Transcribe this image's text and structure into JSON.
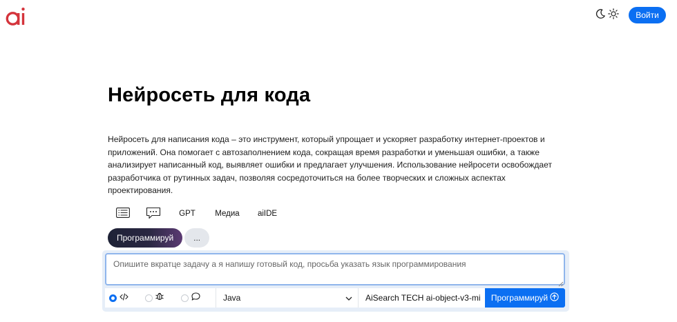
{
  "header": {
    "logo_text": "ai",
    "theme_icons": [
      "moon-icon",
      "sun-icon"
    ],
    "login_label": "Войти"
  },
  "page": {
    "title": "Нейросеть для кода",
    "description": "Нейросеть для написания кода – это инструмент, который упрощает и ускоряет разработку интернет-проектов и приложений. Она помогает с автозаполнением кода, сокращая время разработки и уменьшая ошибки, а также анализирует написанный код, выявляет ошибки и предлагает улучшения. Использование нейросети освобождает разработчика от рутинных задач, позволяя сосредоточиться на более творческих и сложных аспектах проектирования."
  },
  "modes": {
    "items": [
      {
        "icon": "list-icon"
      },
      {
        "icon": "chat-icon"
      },
      {
        "label": "GPT"
      },
      {
        "label": "Медиа"
      },
      {
        "label": "aiIDE"
      }
    ]
  },
  "submodes": {
    "active_label": "Программируй",
    "more_label": "..."
  },
  "composer": {
    "placeholder": "Опишите вкратце задачу а я напишу готовый код, просьба указать язык программирования",
    "value": "",
    "task_types": [
      {
        "icon": "code-icon",
        "selected": true
      },
      {
        "icon": "bug-icon",
        "selected": false
      },
      {
        "icon": "comment-icon",
        "selected": false
      }
    ],
    "language_select": "Java",
    "model_select": "AiSearch TECH ai-object-v3-mi",
    "submit_label": "Программируй"
  },
  "colors": {
    "accent": "#0b6ff2",
    "logo": "#d4343c",
    "active_pill_start": "#1e2236",
    "active_pill_end": "#5b3a73"
  }
}
